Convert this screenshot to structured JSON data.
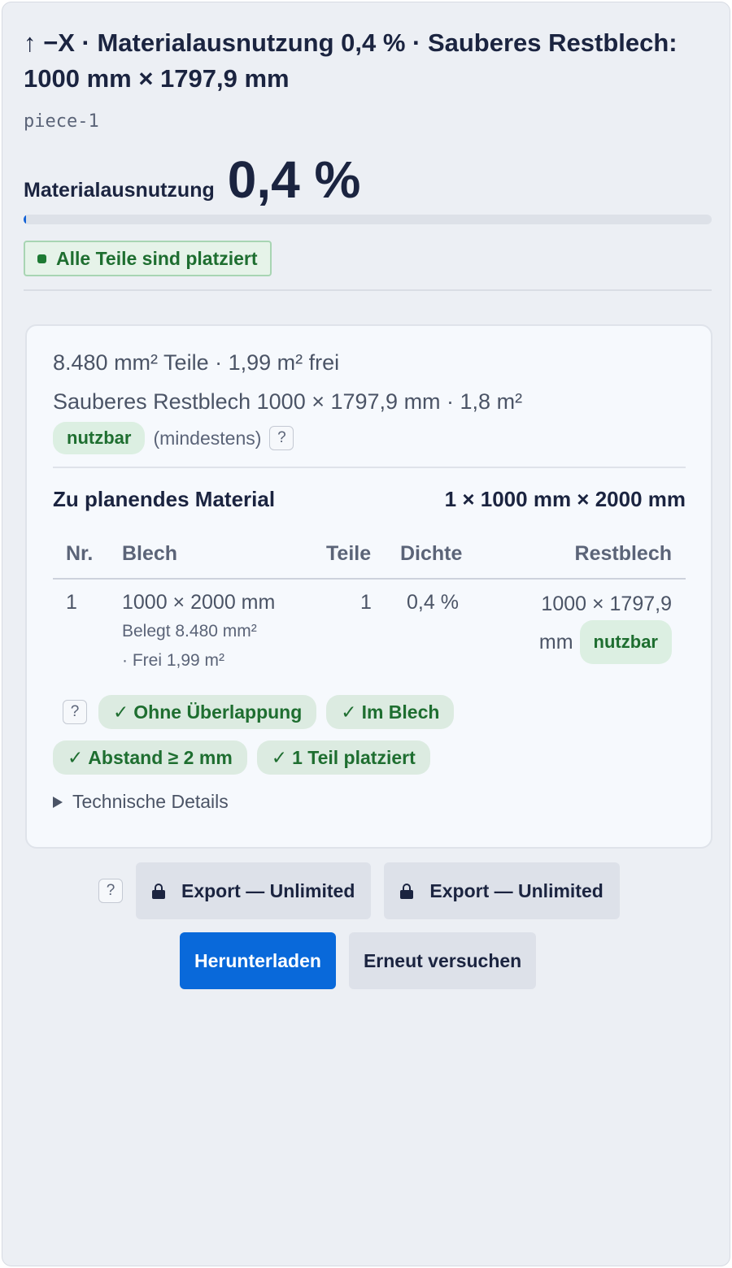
{
  "header": {
    "title": "↑ −X · Materialausnutzung 0,4 % · Sauberes Restblech: 1000 mm × 1797,9 mm",
    "piece_id": "piece-1"
  },
  "utilization": {
    "label": "Materialausnutzung",
    "value": "0,4 %",
    "fraction": 0.004
  },
  "status": {
    "label": "Alle Teile sind platziert"
  },
  "summary": {
    "line1": "8.480 mm² Teile · 1,99 m² frei",
    "line2": "Sauberes Restblech 1000 × 1797,9 mm · 1,8 m²",
    "usable_tag": "nutzbar",
    "qualifier": "(mindestens)",
    "help": "?"
  },
  "material": {
    "label": "Zu planendes Material",
    "value": "1 × 1000 mm × 2000 mm"
  },
  "table": {
    "headers": {
      "nr": "Nr.",
      "sheet": "Blech",
      "parts": "Teile",
      "density": "Dichte",
      "remnant": "Restblech"
    },
    "rows": [
      {
        "nr": "1",
        "sheet": "1000 × 2000 mm",
        "occupied": "Belegt 8.480 mm²",
        "free": "· Frei 1,99 m²",
        "parts": "1",
        "density": "0,4 %",
        "remnant_line1": "1000 × 1797,9",
        "remnant_line2": "mm",
        "remnant_tag": "nutzbar"
      }
    ]
  },
  "checks": {
    "help": "?",
    "items": [
      "Ohne Überlappung",
      "Im Blech",
      "Abstand ≥ 2 mm",
      "1 Teil platziert"
    ]
  },
  "details": {
    "label": "Technische Details"
  },
  "export": {
    "help": "?",
    "buttons": [
      "Export — Unlimited",
      "Export — Unlimited"
    ]
  },
  "actions": {
    "download": "Herunterladen",
    "retry": "Erneut versuchen"
  },
  "colors": {
    "accent": "#0969da",
    "progress": "#1463d6",
    "success": "#1e6e30",
    "success_bg": "#dcebe1"
  }
}
